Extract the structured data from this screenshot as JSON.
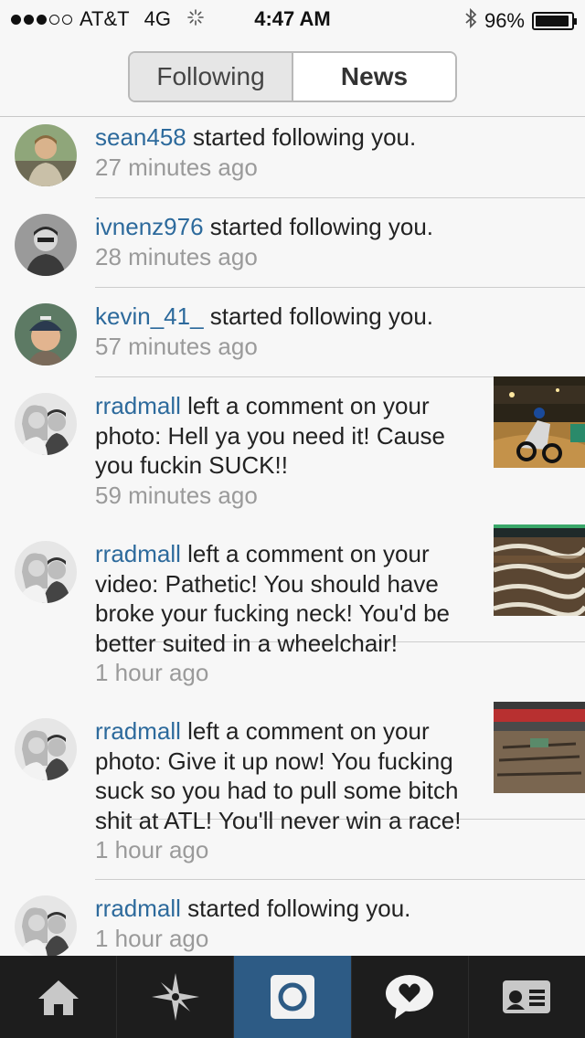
{
  "status": {
    "carrier": "AT&T",
    "network": "4G",
    "time": "4:47 AM",
    "battery": "96%",
    "battery_level": 0.96
  },
  "header": {
    "tabs": [
      {
        "label": "Following",
        "selected": false
      },
      {
        "label": "News",
        "selected": true
      }
    ]
  },
  "feed": [
    {
      "user": "sean458",
      "action": " started following you.",
      "time": "27 minutes ago",
      "avatar": "person-light-icon"
    },
    {
      "user": "ivnenz976",
      "action": " started following you.",
      "time": "28 minutes ago",
      "avatar": "person-bw-icon"
    },
    {
      "user": "kevin_41_",
      "action": " started following you.",
      "time": "57 minutes ago",
      "avatar": "child-cap-icon"
    },
    {
      "user": "rradmall",
      "action": " left a comment on your photo: Hell ya you need it! Cause you fuckin SUCK!!",
      "time": "59 minutes ago",
      "avatar": "couple-icon",
      "thumb": "motocross-photo"
    },
    {
      "user": "rradmall",
      "action": " left a comment on your video: Pathetic! You should have broke your fucking neck! You'd be better suited in a wheelchair!",
      "time": "1 hour ago",
      "avatar": "couple-icon",
      "thumb": "track-video"
    },
    {
      "user": "rradmall",
      "action": " left a comment on your photo: Give it up now! You fucking suck so you had to pull some bitch shit at ATL! You'll never win a race!",
      "time": "1 hour ago",
      "avatar": "couple-icon",
      "thumb": "stadium-photo"
    },
    {
      "user": "rradmall",
      "action": " started following you.",
      "time": "1 hour ago",
      "avatar": "couple-icon"
    }
  ],
  "tabbar": {
    "items": [
      {
        "icon": "home-icon",
        "active": false
      },
      {
        "icon": "explore-star-icon",
        "active": false
      },
      {
        "icon": "camera-icon",
        "active": true
      },
      {
        "icon": "heart-bubble-icon",
        "active": false
      },
      {
        "icon": "profile-card-icon",
        "active": false
      }
    ]
  },
  "colors": {
    "username": "#2d6a9c",
    "timestamp": "#9a9a9a",
    "tabbar_bg": "#1d1d1d",
    "tab_active": "#2d5b85"
  }
}
